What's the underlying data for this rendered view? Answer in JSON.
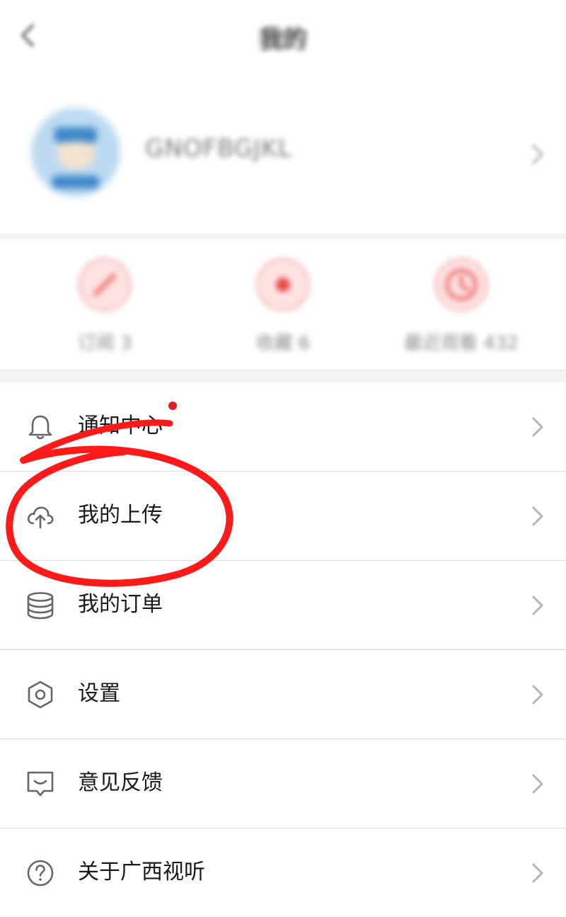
{
  "header": {
    "title": "我的",
    "back_icon": "chevron-left-icon"
  },
  "profile": {
    "username": "GNOFBGJKL",
    "avatar_icon": "avatar-icon"
  },
  "quick_actions": [
    {
      "label": "订阅 3",
      "icon": "pencil-icon"
    },
    {
      "label": "收藏 6",
      "icon": "heart-icon"
    },
    {
      "label": "最近观看 432",
      "icon": "clock-icon"
    }
  ],
  "menu": [
    {
      "label": "通知中心",
      "icon": "bell-icon",
      "badge": true
    },
    {
      "label": "我的上传",
      "icon": "cloud-upload-icon"
    },
    {
      "label": "我的订单",
      "icon": "coins-icon"
    },
    {
      "label": "设置",
      "icon": "hexagon-settings-icon"
    },
    {
      "label": "意见反馈",
      "icon": "feedback-icon"
    },
    {
      "label": "关于广西视听",
      "icon": "question-icon"
    }
  ],
  "colors": {
    "accent_red": "#e02020",
    "annotation_red": "#ff1a1a",
    "icon_gray": "#666666",
    "chevron_gray": "#b5b5b5"
  }
}
